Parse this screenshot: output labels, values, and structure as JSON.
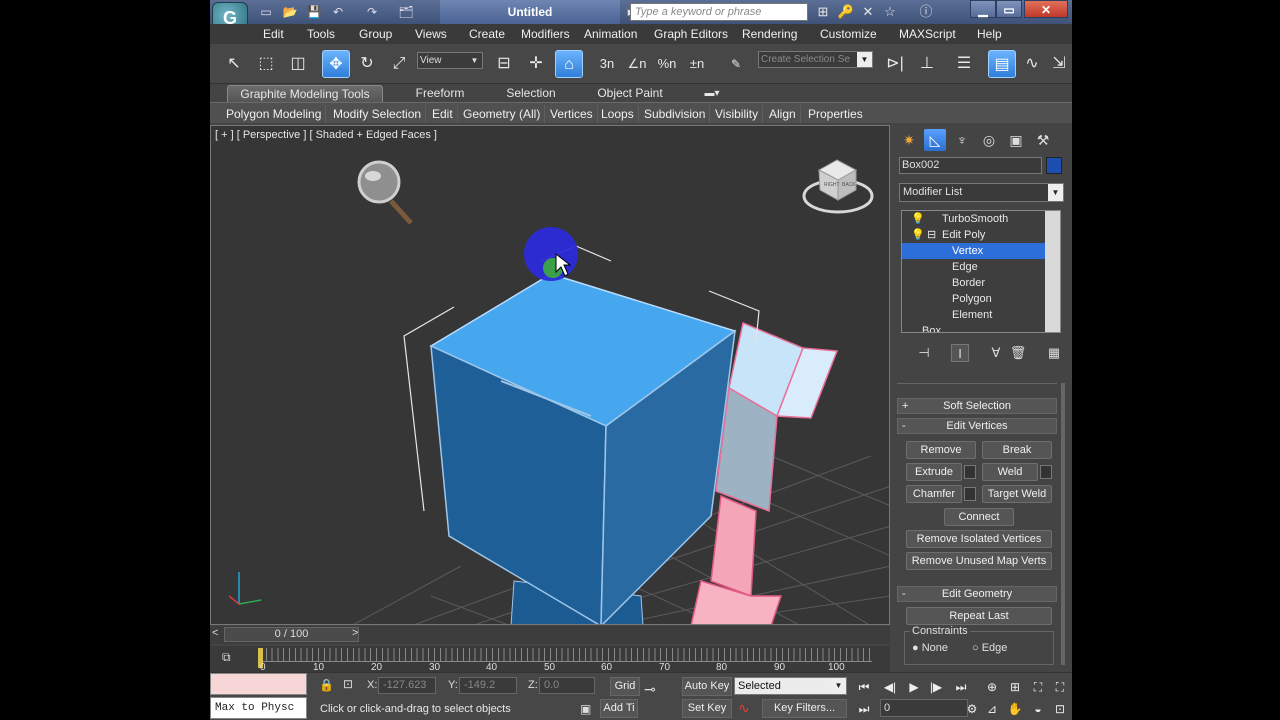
{
  "window": {
    "title": "Untitled",
    "search_placeholder": "Type a keyword or phrase",
    "app_logo": "G"
  },
  "menu": [
    "Edit",
    "Tools",
    "Group",
    "Views",
    "Create",
    "Modifiers",
    "Animation",
    "Graph Editors",
    "Rendering",
    "Customize",
    "MAXScript",
    "Help"
  ],
  "toolbar": {
    "view_dropdown": "View",
    "selection_set_placeholder": "Create Selection Se",
    "snap_labels": [
      "3n",
      "∠n",
      "%n",
      "±n"
    ]
  },
  "ribbon": {
    "tabs": [
      "Graphite Modeling Tools",
      "Freeform",
      "Selection",
      "Object Paint"
    ],
    "active_tab": "Graphite Modeling Tools",
    "panels": [
      "Polygon Modeling",
      "Modify Selection",
      "Edit",
      "Geometry (All)",
      "Vertices",
      "Loops",
      "Subdivision",
      "Visibility",
      "Align",
      "Properties"
    ]
  },
  "viewport": {
    "label": "[ + ] [ Perspective ] [ Shaded + Edged Faces ]",
    "viewcube_faces": [
      "RIGHT",
      "BACK"
    ]
  },
  "command_panel": {
    "object_name": "Box002",
    "object_color": "#1c4fb0",
    "modifier_list": "Modifier List",
    "stack": [
      "TurboSmooth",
      "Edit Poly",
      "Vertex",
      "Edge",
      "Border",
      "Polygon",
      "Element",
      "Box"
    ],
    "stack_selected": "Vertex",
    "rollouts": {
      "soft_selection": {
        "sign": "+",
        "title": "Soft Selection"
      },
      "edit_vertices": {
        "sign": "-",
        "title": "Edit Vertices",
        "remove": "Remove",
        "break": "Break",
        "extrude": "Extrude",
        "weld": "Weld",
        "chamfer": "Chamfer",
        "target_weld": "Target Weld",
        "connect": "Connect",
        "remove_isolated": "Remove Isolated Vertices",
        "remove_unused": "Remove Unused Map Verts"
      },
      "edit_geometry": {
        "sign": "-",
        "title": "Edit Geometry",
        "repeat_last": "Repeat Last",
        "constraints_label": "Constraints",
        "constraint_none": "None",
        "constraint_edge": "Edge"
      }
    }
  },
  "timeline": {
    "frame_display": "0 / 100",
    "ticks": [
      "0",
      "10",
      "20",
      "30",
      "40",
      "50",
      "60",
      "70",
      "80",
      "90",
      "100"
    ],
    "arrow_left": "<",
    "arrow_right": ">"
  },
  "status": {
    "maxscript_text": "Max to Physc",
    "coords": {
      "x_label": "X:",
      "x": "-127.623",
      "y_label": "Y:",
      "y": "-149.2",
      "z_label": "Z:",
      "z": "0.0"
    },
    "grid_label": "Grid",
    "auto_key": "Auto Key",
    "set_key": "Set Key",
    "key_filters": "Key Filters...",
    "add_time_tag": "Add Ti",
    "selection_dropdown": "Selected",
    "current_frame": "0",
    "hint": "Click or click-and-drag to select objects"
  },
  "colors": {
    "accent": "#2d6fd8",
    "selection_highlight": "#f4a6b8",
    "box_top": "#46a6ee",
    "box_front": "#1f5f98"
  }
}
